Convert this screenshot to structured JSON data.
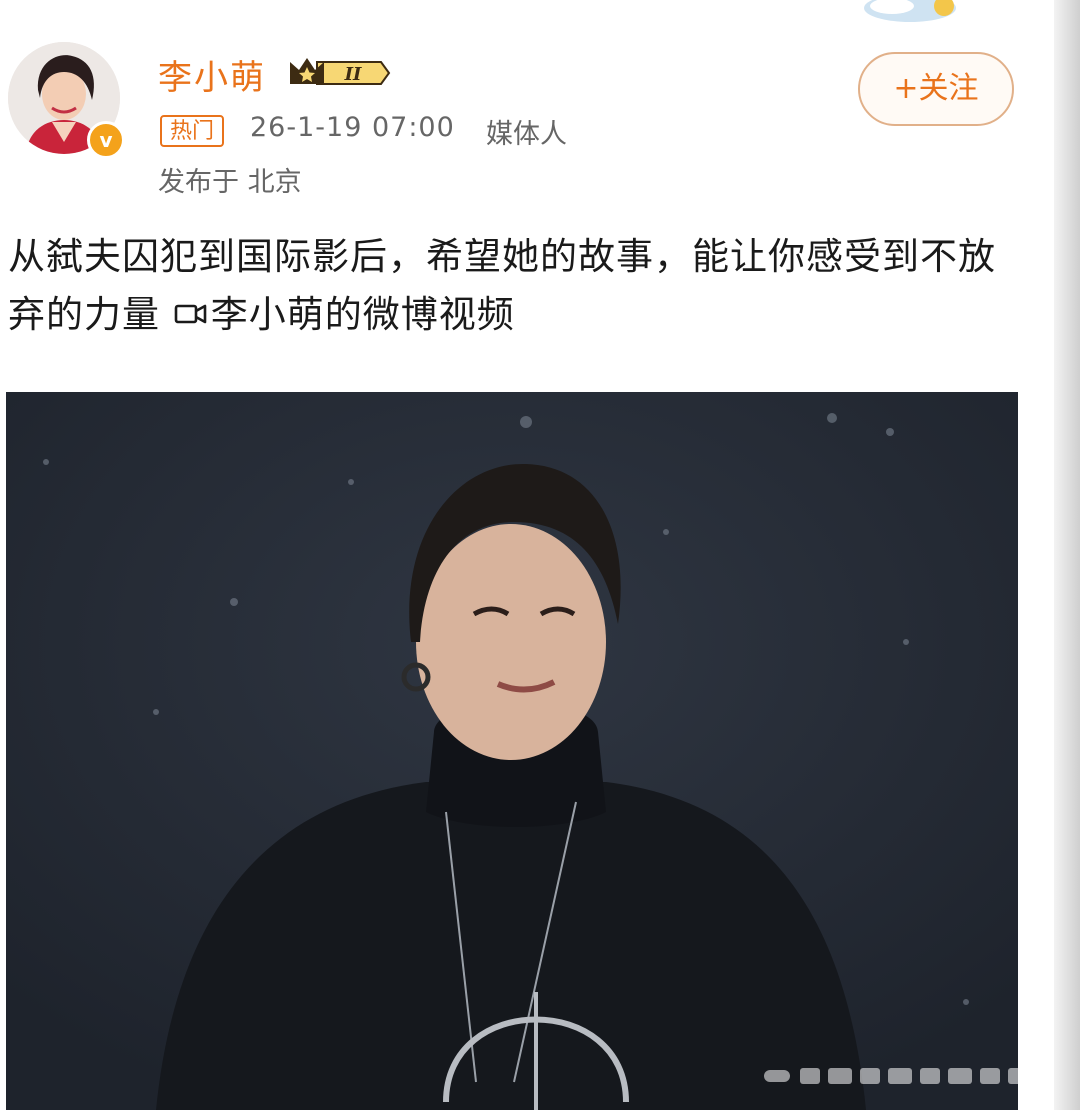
{
  "post": {
    "author": {
      "name": "李小萌",
      "vip_level": "II",
      "verified": true
    },
    "hot_tag": "热门",
    "time": "26-1-19 07:00",
    "source": "媒体人",
    "location": "发布于 北京",
    "follow_label": "+关注",
    "text": "从弑夫囚犯到国际影后，希望她的故事，能让你感受到不放弃的力量 ",
    "video_link_text": "李小萌的微博视频"
  },
  "icons": {
    "verified": "verified-v-icon",
    "vip": "crown-vip-icon",
    "video": "video-camera-icon"
  },
  "colors": {
    "accent": "#e9731b",
    "meta_text": "#666666",
    "body_text": "#1a1a1a",
    "video_bg": "#262c37"
  }
}
